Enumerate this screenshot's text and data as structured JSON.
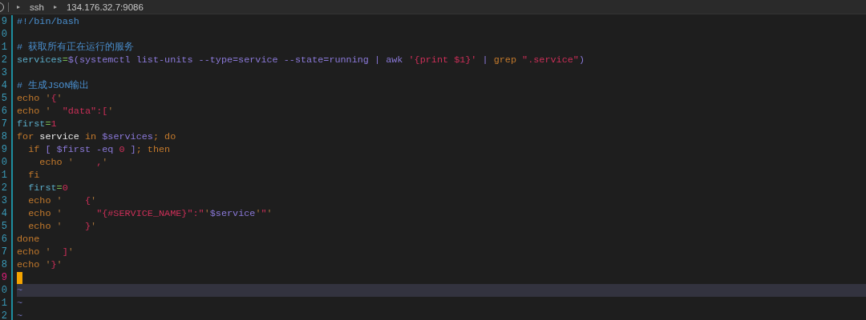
{
  "breadcrumb": [
    "▸",
    "ssh",
    "▸",
    "134.176.32.7:9086"
  ],
  "lines": [
    {
      "number": "9",
      "current": false,
      "highlighted": false,
      "tokens": [
        {
          "kind": "comment",
          "text": "#!/bin/bash"
        }
      ]
    },
    {
      "number": "0",
      "current": false,
      "highlighted": false
    },
    {
      "number": "1",
      "current": false,
      "highlighted": false,
      "tokens": [
        {
          "kind": "comment",
          "text": "# 获取所有正在运行的服务"
        }
      ]
    },
    {
      "number": "2",
      "current": false,
      "highlighted": false,
      "tokens": [
        {
          "kind": "var",
          "text": "services"
        },
        {
          "kind": "op",
          "text": "="
        },
        {
          "kind": "call",
          "text": "$(systemctl list-units --type=service --state=running | awk "
        },
        {
          "kind": "str",
          "text": "'{print $1}'"
        },
        {
          "kind": "call",
          "text": " | "
        },
        {
          "kind": "kw",
          "text": "grep "
        },
        {
          "kind": "str",
          "text": "\".service\""
        },
        {
          "kind": "call",
          "text": ")"
        }
      ]
    },
    {
      "number": "3",
      "current": false,
      "highlighted": false
    },
    {
      "number": "4",
      "current": false,
      "highlighted": false,
      "tokens": [
        {
          "kind": "comment",
          "text": "# 生成JSON输出"
        }
      ]
    },
    {
      "number": "5",
      "current": false,
      "highlighted": false,
      "tokens": [
        {
          "kind": "kw",
          "text": "echo "
        },
        {
          "kind": "quote",
          "text": "'"
        },
        {
          "kind": "str",
          "text": "{"
        },
        {
          "kind": "quote",
          "text": "'"
        }
      ]
    },
    {
      "number": "6",
      "current": false,
      "highlighted": false,
      "tokens": [
        {
          "kind": "kw",
          "text": "echo "
        },
        {
          "kind": "quote",
          "text": "'"
        },
        {
          "kind": "str",
          "text": "  \"data\":["
        },
        {
          "kind": "quote",
          "text": "'"
        }
      ]
    },
    {
      "number": "7",
      "current": false,
      "highlighted": false,
      "tokens": [
        {
          "kind": "var",
          "text": "first"
        },
        {
          "kind": "op",
          "text": "="
        },
        {
          "kind": "num",
          "text": "1"
        }
      ]
    },
    {
      "number": "8",
      "current": false,
      "highlighted": false,
      "tokens": [
        {
          "kind": "kw",
          "text": "for"
        },
        {
          "kind": "plain",
          "text": " service"
        },
        {
          "kind": "kw",
          "text": " in"
        },
        {
          "kind": "call",
          "text": " $services"
        },
        {
          "kind": "kw",
          "text": "; do"
        }
      ]
    },
    {
      "number": "9",
      "current": false,
      "highlighted": false,
      "tokens": [
        {
          "kind": "kw",
          "text": "  if"
        },
        {
          "kind": "call",
          "text": " [ $first -eq"
        },
        {
          "kind": "num",
          "text": " 0"
        },
        {
          "kind": "call",
          "text": " ]"
        },
        {
          "kind": "kw",
          "text": "; then"
        }
      ]
    },
    {
      "number": "0",
      "current": false,
      "highlighted": false,
      "tokens": [
        {
          "kind": "kw",
          "text": "    echo "
        },
        {
          "kind": "quote",
          "text": "'"
        },
        {
          "kind": "str",
          "text": "    ,"
        },
        {
          "kind": "quote",
          "text": "'"
        }
      ]
    },
    {
      "number": "1",
      "current": false,
      "highlighted": false,
      "tokens": [
        {
          "kind": "kw",
          "text": "  fi"
        }
      ]
    },
    {
      "number": "2",
      "current": false,
      "highlighted": false,
      "tokens": [
        {
          "kind": "var",
          "text": "  first"
        },
        {
          "kind": "op",
          "text": "="
        },
        {
          "kind": "num",
          "text": "0"
        }
      ]
    },
    {
      "number": "3",
      "current": false,
      "highlighted": false,
      "tokens": [
        {
          "kind": "kw",
          "text": "  echo "
        },
        {
          "kind": "quote",
          "text": "'"
        },
        {
          "kind": "str",
          "text": "    {"
        },
        {
          "kind": "quote",
          "text": "'"
        }
      ]
    },
    {
      "number": "4",
      "current": false,
      "highlighted": false,
      "tokens": [
        {
          "kind": "kw",
          "text": "  echo "
        },
        {
          "kind": "quote",
          "text": "'"
        },
        {
          "kind": "str",
          "text": "      \"{#SERVICE_NAME}\":\""
        },
        {
          "kind": "quote",
          "text": "'"
        },
        {
          "kind": "call",
          "text": "$service"
        },
        {
          "kind": "quote",
          "text": "'"
        },
        {
          "kind": "str",
          "text": "\""
        },
        {
          "kind": "quote",
          "text": "'"
        }
      ]
    },
    {
      "number": "5",
      "current": false,
      "highlighted": false,
      "tokens": [
        {
          "kind": "kw",
          "text": "  echo "
        },
        {
          "kind": "quote",
          "text": "'"
        },
        {
          "kind": "str",
          "text": "    }"
        },
        {
          "kind": "quote",
          "text": "'"
        }
      ]
    },
    {
      "number": "6",
      "current": false,
      "highlighted": false,
      "tokens": [
        {
          "kind": "kw",
          "text": "done"
        }
      ]
    },
    {
      "number": "7",
      "current": false,
      "highlighted": false,
      "tokens": [
        {
          "kind": "kw",
          "text": "echo "
        },
        {
          "kind": "quote",
          "text": "'"
        },
        {
          "kind": "str",
          "text": "  ]"
        },
        {
          "kind": "quote",
          "text": "'"
        }
      ]
    },
    {
      "number": "8",
      "current": false,
      "highlighted": false,
      "tokens": [
        {
          "kind": "kw",
          "text": "echo "
        },
        {
          "kind": "quote",
          "text": "'"
        },
        {
          "kind": "str",
          "text": "}"
        },
        {
          "kind": "quote",
          "text": "'"
        }
      ]
    },
    {
      "number": "9",
      "current": true,
      "highlighted": false
    },
    {
      "number": "0",
      "current": false,
      "highlighted": true,
      "tokens": [
        {
          "kind": "tilde",
          "text": "~"
        }
      ]
    },
    {
      "number": "1",
      "current": false,
      "highlighted": false,
      "tokens": [
        {
          "kind": "tilde",
          "text": "~"
        }
      ]
    },
    {
      "number": "2",
      "current": false,
      "highlighted": false,
      "tokens": [
        {
          "kind": "tilde",
          "text": "~"
        }
      ]
    }
  ]
}
